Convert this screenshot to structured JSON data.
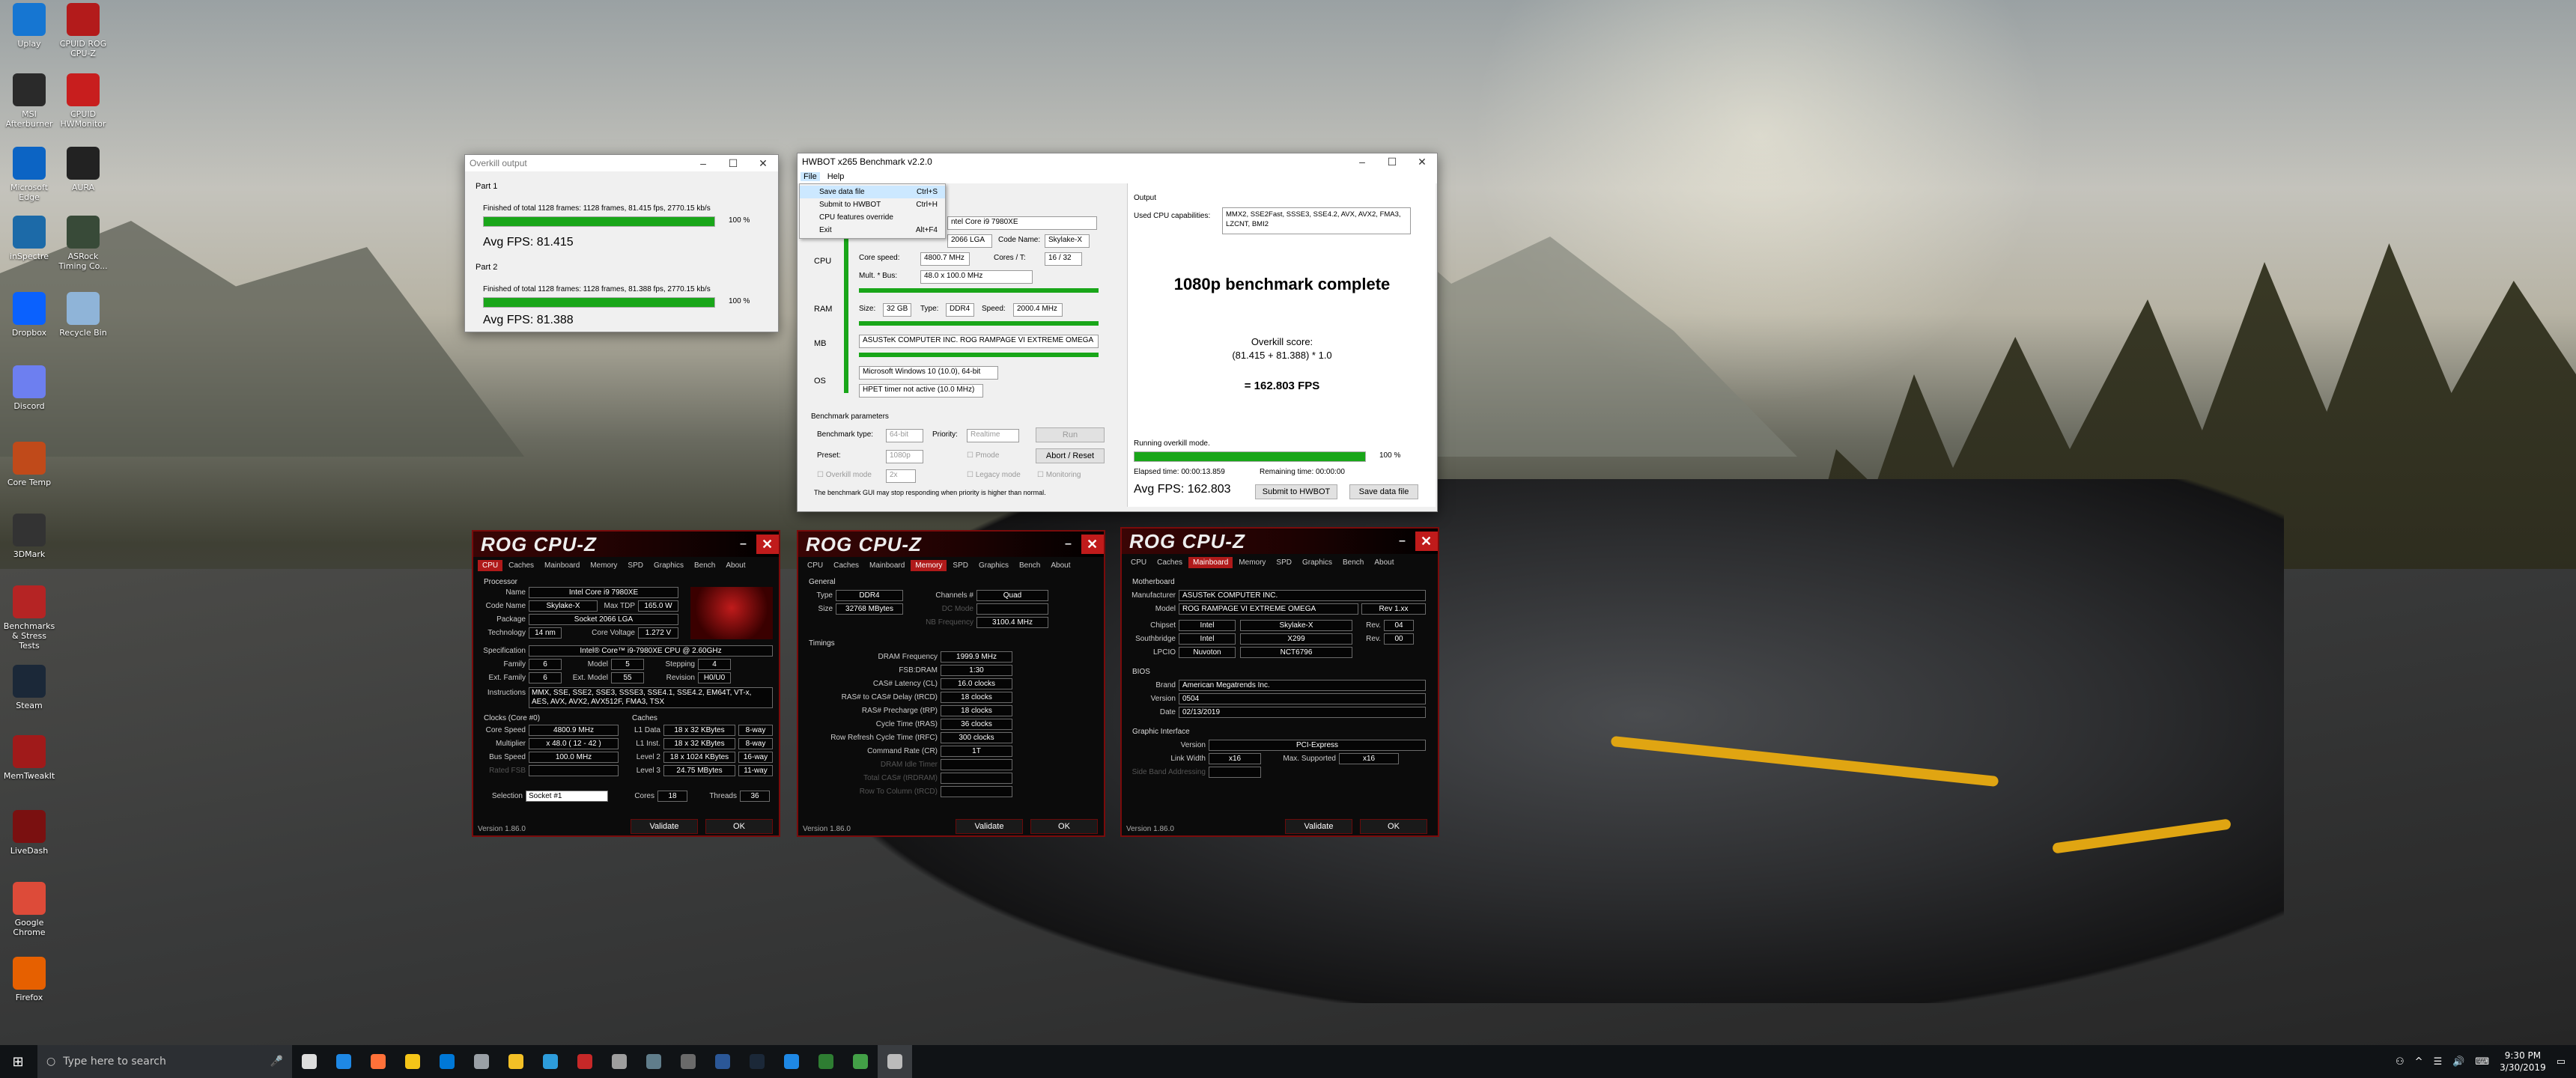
{
  "desktop_icons": [
    {
      "label": "Uplay",
      "color": "#1676d2"
    },
    {
      "label": "CPUID ROG CPU-Z",
      "color": "#b31b1b"
    },
    {
      "label": "MSI Afterburner",
      "color": "#2a2a2a"
    },
    {
      "label": "CPUID HWMonitor",
      "color": "#c81e1e"
    },
    {
      "label": "Microsoft Edge",
      "color": "#0c64c4"
    },
    {
      "label": "AURA",
      "color": "#222"
    },
    {
      "label": "inSpectre",
      "color": "#1c6aa8"
    },
    {
      "label": "ASRock Timing Co...",
      "color": "#384a38"
    },
    {
      "label": "Dropbox",
      "color": "#0a61fe"
    },
    {
      "label": "Recycle Bin",
      "color": "#8fb4d8"
    },
    {
      "label": "Discord",
      "color": "#6d7ff0"
    },
    {
      "label": "Core Temp",
      "color": "#c04a1a"
    },
    {
      "label": "3DMark",
      "color": "#333"
    },
    {
      "label": "Benchmarks & Stress Tests",
      "color": "#b52424"
    },
    {
      "label": "Steam",
      "color": "#1b2838"
    },
    {
      "label": "MemTweakIt",
      "color": "#a01a1a"
    },
    {
      "label": "LiveDash",
      "color": "#7a1010"
    },
    {
      "label": "Google Chrome",
      "color": "#dd4b39"
    },
    {
      "label": "Firefox",
      "color": "#e66000"
    }
  ],
  "overkill": {
    "title": "Overkill output",
    "part1": "Part 1",
    "part1_status": "Finished of total 1128 frames: 1128 frames, 81.415 fps,  2770.15 kb/s",
    "part1_pct": "100 %",
    "part1_progress": 1.0,
    "part1_avg": "Avg FPS: 81.415",
    "part2": "Part 2",
    "part2_status": "Finished of total 1128 frames: 1128 frames, 81.388 fps,  2770.15 kb/s",
    "part2_pct": "100 %",
    "part2_progress": 1.0,
    "part2_avg": "Avg FPS: 81.388"
  },
  "hwbot": {
    "title": "HWBOT x265 Benchmark v2.2.0",
    "menu": {
      "file": "File",
      "help": "Help"
    },
    "file_menu": [
      {
        "label": "Save data file",
        "shortcut": "Ctrl+S"
      },
      {
        "label": "Submit to HWBOT",
        "shortcut": "Ctrl+H"
      },
      {
        "label": "CPU features override",
        "shortcut": ""
      },
      {
        "label": "Exit",
        "shortcut": "Alt+F4"
      }
    ],
    "sys": {
      "cpu_label": "CPU",
      "ram_label": "RAM",
      "mb_label": "MB",
      "os_label": "OS",
      "cpu_name": "ntel Core i9 7980XE",
      "cpu_socket": "2066 LGA",
      "code_name_lbl": "Code Name:",
      "code_name": "Skylake-X",
      "core_speed_lbl": "Core speed:",
      "core_speed": "4800.7 MHz",
      "cores_lbl": "Cores / T:",
      "cores": "16 / 32",
      "mult_lbl": "Mult. * Bus:",
      "mult": "48.0 x 100.0 MHz",
      "size_lbl": "Size:",
      "size": "32 GB",
      "type_lbl": "Type:",
      "type": "DDR4",
      "speed_lbl": "Speed:",
      "speed": "2000.4 MHz",
      "mb": "ASUSTeK COMPUTER INC. ROG RAMPAGE VI EXTREME OMEGA",
      "os": "Microsoft Windows 10 (10.0), 64-bit",
      "timer": "HPET timer not active (10.0 MHz)"
    },
    "output": {
      "label": "Output",
      "caps_lbl": "Used CPU capabilities:",
      "caps": "MMX2, SSE2Fast, SSSE3, SSE4.2, AVX, AVX2, FMA3, LZCNT, BMI2",
      "headline": "1080p benchmark complete",
      "score_lbl": "Overkill score:",
      "formula": "(81.415 + 81.388) * 1.0",
      "result": "= 162.803 FPS",
      "running": "Running overkill mode.",
      "pct": "100 %",
      "progress": 1.0,
      "elapsed": "Elapsed time: 00:00:13.859",
      "remaining": "Remaining time: 00:00:00",
      "avg": "Avg FPS: 162.803",
      "submit": "Submit to HWBOT",
      "save": "Save data file"
    },
    "params": {
      "label": "Benchmark parameters",
      "type_lbl": "Benchmark type:",
      "type": "64-bit",
      "prio_lbl": "Priority:",
      "prio": "Realtime",
      "run": "Run",
      "preset_lbl": "Preset:",
      "preset": "1080p",
      "pmode": "Pmode",
      "abort": "Abort / Reset",
      "overkill": "Overkill mode",
      "overkill_val": "2x",
      "legacy": "Legacy mode",
      "monitoring": "Monitoring",
      "note": "The benchmark GUI may stop responding when priority is higher than normal."
    }
  },
  "cpuz_tabs": [
    "CPU",
    "Caches",
    "Mainboard",
    "Memory",
    "SPD",
    "Graphics",
    "Bench",
    "About"
  ],
  "cpuz_title": "ROG CPU-Z",
  "cpuz_version": "Version 1.86.0",
  "cpuz_validate": "Validate",
  "cpuz_ok": "OK",
  "cpu": {
    "proc": "Processor",
    "name_l": "Name",
    "name": "Intel Core i9 7980XE",
    "code_l": "Code Name",
    "code": "Skylake-X",
    "tdp_l": "Max TDP",
    "tdp": "165.0 W",
    "pkg_l": "Package",
    "pkg": "Socket 2066 LGA",
    "tech_l": "Technology",
    "tech": "14 nm",
    "volt_l": "Core Voltage",
    "volt": "1.272 V",
    "spec_l": "Specification",
    "spec": "Intel® Core™ i9-7980XE CPU @ 2.60GHz",
    "fam_l": "Family",
    "fam": "6",
    "model_l": "Model",
    "model": "5",
    "step_l": "Stepping",
    "step": "4",
    "efam_l": "Ext. Family",
    "efam": "6",
    "emodel_l": "Ext. Model",
    "emodel": "55",
    "rev_l": "Revision",
    "rev": "H0/U0",
    "instr_l": "Instructions",
    "instr": "MMX, SSE, SSE2, SSE3, SSSE3, SSE4.1, SSE4.2, EM64T, VT-x, AES, AVX, AVX2, AVX512F, FMA3, TSX",
    "clocks": "Clocks (Core #0)",
    "caches": "Caches",
    "cs_l": "Core Speed",
    "cs": "4800.9 MHz",
    "mul_l": "Multiplier",
    "mul": "x 48.0 ( 12 - 42 )",
    "bus_l": "Bus Speed",
    "bus": "100.0 MHz",
    "fsb_l": "Rated FSB",
    "fsb": "",
    "l1d_l": "L1 Data",
    "l1d": "18 x 32 KBytes",
    "l1d_w": "8-way",
    "l1i_l": "L1 Inst.",
    "l1i": "18 x 32 KBytes",
    "l1i_w": "8-way",
    "l2_l": "Level 2",
    "l2": "18 x 1024 KBytes",
    "l2_w": "16-way",
    "l3_l": "Level 3",
    "l3": "24.75 MBytes",
    "l3_w": "11-way",
    "sel_l": "Selection",
    "sel": "Socket #1",
    "cores_l": "Cores",
    "cores": "18",
    "thr_l": "Threads",
    "thr": "36"
  },
  "mem": {
    "general": "General",
    "type_l": "Type",
    "type": "DDR4",
    "ch_l": "Channels #",
    "ch": "Quad",
    "size_l": "Size",
    "size": "32768 MBytes",
    "dc_l": "DC Mode",
    "dc": "",
    "nb_l": "NB Frequency",
    "nb": "3100.4 MHz",
    "timings": "Timings",
    "rows": [
      {
        "l": "DRAM Frequency",
        "v": "1999.9 MHz"
      },
      {
        "l": "FSB:DRAM",
        "v": "1:30"
      },
      {
        "l": "CAS# Latency (CL)",
        "v": "16.0 clocks"
      },
      {
        "l": "RAS# to CAS# Delay (tRCD)",
        "v": "18 clocks"
      },
      {
        "l": "RAS# Precharge (tRP)",
        "v": "18 clocks"
      },
      {
        "l": "Cycle Time (tRAS)",
        "v": "36 clocks"
      },
      {
        "l": "Row Refresh Cycle Time (tRFC)",
        "v": "300 clocks"
      },
      {
        "l": "Command Rate (CR)",
        "v": "1T"
      },
      {
        "l": "DRAM Idle Timer",
        "v": ""
      },
      {
        "l": "Total CAS# (tRDRAM)",
        "v": ""
      },
      {
        "l": "Row To Column (tRCD)",
        "v": ""
      }
    ]
  },
  "mb": {
    "mboard": "Motherboard",
    "man_l": "Manufacturer",
    "man": "ASUSTeK COMPUTER INC.",
    "model_l": "Model",
    "model": "ROG RAMPAGE VI EXTREME OMEGA",
    "model_rev": "Rev 1.xx",
    "chip_l": "Chipset",
    "chip": "Intel",
    "chip2": "Skylake-X",
    "chip_rev_l": "Rev.",
    "chip_rev": "04",
    "south_l": "Southbridge",
    "south": "Intel",
    "south2": "X299",
    "south_rev": "00",
    "lpc_l": "LPCIO",
    "lpc": "Nuvoton",
    "lpc2": "NCT6796",
    "bios": "BIOS",
    "brand_l": "Brand",
    "brand": "American Megatrends Inc.",
    "bver_l": "Version",
    "bver": "0504",
    "date_l": "Date",
    "date": "02/13/2019",
    "gi": "Graphic Interface",
    "gver_l": "Version",
    "gver": "PCI-Express",
    "lw_l": "Link Width",
    "lw": "x16",
    "ms_l": "Max. Supported",
    "ms": "x16",
    "sb_l": "Side Band Addressing",
    "sb": ""
  },
  "taskbar": {
    "search": "Type here to search",
    "time": "9:30 PM",
    "date": "3/30/2019"
  }
}
